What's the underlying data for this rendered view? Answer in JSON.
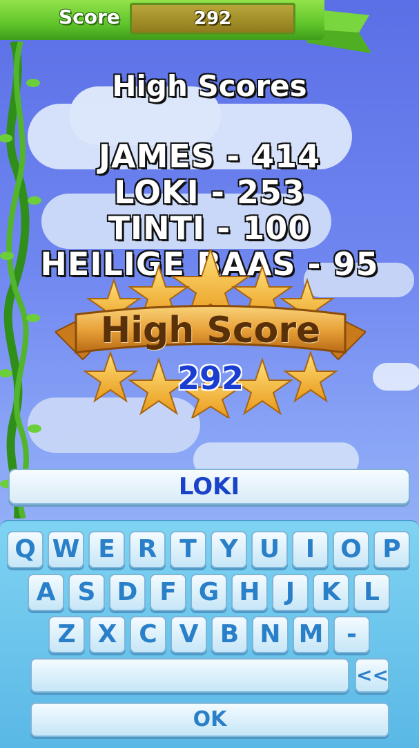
{
  "header": {
    "score_label": "Score",
    "score_value": "292"
  },
  "high_scores": {
    "title": "High Scores",
    "entries": [
      "JAMES - 414",
      "LOKI - 253",
      "TINTI - 100",
      "HEILIGE BAAS - 95"
    ]
  },
  "badge": {
    "title": "High Score",
    "score": "292"
  },
  "name_input": {
    "value": "LOKI"
  },
  "keyboard": {
    "row1": [
      "Q",
      "W",
      "E",
      "R",
      "T",
      "Y",
      "U",
      "I",
      "O",
      "P"
    ],
    "row2": [
      "A",
      "S",
      "D",
      "F",
      "G",
      "H",
      "J",
      "K",
      "L"
    ],
    "row3": [
      "Z",
      "X",
      "C",
      "V",
      "B",
      "N",
      "M",
      "-"
    ],
    "backspace_label": "<<",
    "ok_label": "OK"
  },
  "colors": {
    "accent_green": "#5fc52a",
    "score_blue": "#1a3fd0",
    "key_text": "#2a7fc9"
  }
}
